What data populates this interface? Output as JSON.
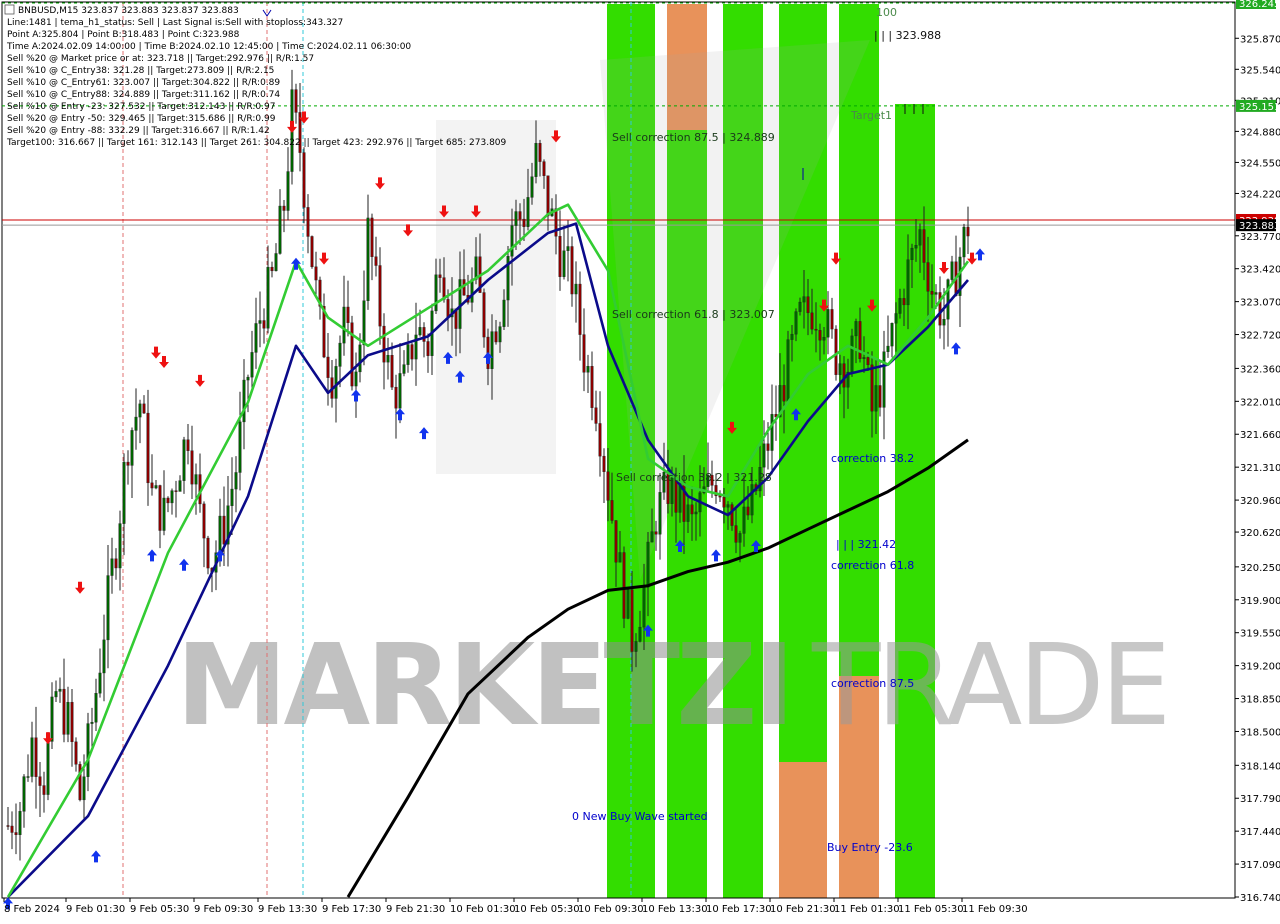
{
  "info": {
    "lines": [
      "BNBUSD,M15  323.837 323.883 323.837 323.883",
      "Line:1481  | tema_h1_status: Sell  | Last Signal is:Sell with stoploss:343.327",
      "Point A:325.804 | Point B:318.483 | Point C:323.988",
      "Time A:2024.02.09 14:00:00 | Time B:2024.02.10 12:45:00 | Time C:2024.02.11 06:30:00",
      "Sell %20 @ Market price or at: 323.718 || Target:292.976 || R/R:1.57",
      "Sell %10 @ C_Entry38: 321.28 || Target:273.809 || R/R:2.15",
      "Sell %10 @ C_Entry61: 323.007 || Target:304.822 || R/R:0.89",
      "Sell %10 @ C_Entry88: 324.889 || Target:311.162 || R/R:0.74",
      "Sell %10 @ Entry -23: 327.532 || Target:312.143 || R/R:0.97",
      "Sell %20 @ Entry -50: 329.465 || Target:315.686 || R/R:0.99",
      "Sell %20 @ Entry -88: 332.29 || Target:316.667 || R/R:1.42",
      "Target100: 316.667 || Target 161: 312.143 || Target 261: 304.822 || Target 423: 292.976 || Target 685: 273.809"
    ]
  },
  "watermark": {
    "part1": "MARKETZI",
    "part2": "TRADE"
  },
  "annotations": {
    "sell_correction_875": "Sell correction 87.5 | 324.889",
    "sell_correction_618": "Sell correction 61.8 | 323.007",
    "sell_correction_382": "Sell correction 38.2 | 321.28",
    "new_buy_wave": "0 New Buy Wave started",
    "correction_382": "correction 38.2",
    "correction_618": "correction 61.8",
    "correction_875": "correction 87.5",
    "buy_entry": "Buy Entry -23.6",
    "target1": "Target1",
    "level_100": "100",
    "level_323988": "| | | 323.988",
    "level_32142": "| | | 321.42"
  },
  "price_tags": {
    "top": "326.245",
    "target_line": "325.151",
    "red_line": "323.938",
    "current": "323.883"
  },
  "colors": {
    "bull_candle": "#006400",
    "bear_candle": "#8b0000",
    "zone_green": "#33dd00",
    "zone_orange": "#e8925a",
    "ma_fast": "#0b0b8a",
    "ma_mid": "#33cc33",
    "ma_slow": "#000000",
    "red_line": "#cc0000",
    "target_line": "#00aa00"
  },
  "chart_data": {
    "type": "candlestick",
    "symbol": "BNBUSD",
    "timeframe": "M15",
    "ylim": [
      316.74,
      326.245
    ],
    "y_ticks": [
      "325.870",
      "325.540",
      "325.210",
      "324.880",
      "324.550",
      "324.220",
      "323.770",
      "323.420",
      "323.070",
      "322.720",
      "322.360",
      "322.010",
      "321.660",
      "321.310",
      "320.960",
      "320.620",
      "320.250",
      "319.900",
      "319.550",
      "319.200",
      "318.850",
      "318.500",
      "318.140",
      "317.790",
      "317.440",
      "317.090",
      "316.740"
    ],
    "x_ticks": [
      "8 Feb 2024",
      "9 Feb 01:30",
      "9 Feb 05:30",
      "9 Feb 09:30",
      "9 Feb 13:30",
      "9 Feb 17:30",
      "9 Feb 21:30",
      "10 Feb 01:30",
      "10 Feb 05:30",
      "10 Feb 09:30",
      "10 Feb 13:30",
      "10 Feb 17:30",
      "10 Feb 21:30",
      "11 Feb 01:30",
      "11 Feb 05:30",
      "11 Feb 09:30"
    ],
    "close_path": [
      [
        0,
        317.5
      ],
      [
        3,
        317.7
      ],
      [
        6,
        318.4
      ],
      [
        9,
        318.0
      ],
      [
        12,
        318.9
      ],
      [
        15,
        318.6
      ],
      [
        18,
        317.8
      ],
      [
        21,
        318.6
      ],
      [
        24,
        319.6
      ],
      [
        27,
        320.5
      ],
      [
        30,
        321.6
      ],
      [
        33,
        322.0
      ],
      [
        36,
        321.0
      ],
      [
        39,
        320.8
      ],
      [
        42,
        321.2
      ],
      [
        45,
        321.7
      ],
      [
        48,
        320.8
      ],
      [
        51,
        320.3
      ],
      [
        54,
        320.7
      ],
      [
        57,
        321.3
      ],
      [
        60,
        322.3
      ],
      [
        63,
        322.9
      ],
      [
        66,
        323.3
      ],
      [
        69,
        324.1
      ],
      [
        71,
        325.1
      ],
      [
        73,
        324.7
      ],
      [
        75,
        323.9
      ],
      [
        78,
        322.8
      ],
      [
        81,
        322.3
      ],
      [
        84,
        322.8
      ],
      [
        87,
        322.2
      ],
      [
        90,
        323.8
      ],
      [
        93,
        322.9
      ],
      [
        96,
        322.1
      ],
      [
        99,
        322.2
      ],
      [
        102,
        322.8
      ],
      [
        105,
        322.6
      ],
      [
        108,
        323.6
      ],
      [
        111,
        322.9
      ],
      [
        114,
        323.1
      ],
      [
        117,
        323.3
      ],
      [
        120,
        322.6
      ],
      [
        123,
        323.0
      ],
      [
        126,
        323.9
      ],
      [
        129,
        324.0
      ],
      [
        132,
        324.6
      ],
      [
        135,
        324.1
      ],
      [
        138,
        323.6
      ],
      [
        141,
        323.3
      ],
      [
        144,
        322.5
      ],
      [
        147,
        322.0
      ],
      [
        150,
        321.1
      ],
      [
        153,
        320.2
      ],
      [
        156,
        319.5
      ],
      [
        159,
        320.0
      ],
      [
        162,
        320.8
      ],
      [
        165,
        321.1
      ],
      [
        168,
        320.9
      ],
      [
        171,
        320.7
      ],
      [
        174,
        321.0
      ],
      [
        177,
        321.2
      ],
      [
        180,
        321.0
      ],
      [
        183,
        320.6
      ],
      [
        186,
        320.9
      ],
      [
        189,
        321.4
      ],
      [
        192,
        321.9
      ],
      [
        195,
        322.4
      ],
      [
        198,
        322.9
      ],
      [
        201,
        323.0
      ],
      [
        204,
        322.9
      ],
      [
        207,
        322.5
      ],
      [
        210,
        322.4
      ],
      [
        213,
        322.7
      ],
      [
        216,
        321.9
      ],
      [
        219,
        322.3
      ],
      [
        222,
        322.9
      ],
      [
        225,
        323.4
      ],
      [
        228,
        323.8
      ],
      [
        231,
        323.2
      ],
      [
        234,
        322.9
      ],
      [
        237,
        323.4
      ],
      [
        240,
        323.883
      ]
    ],
    "series": [
      {
        "values": [
          [
            0,
            316.74
          ],
          [
            20,
            317.6
          ],
          [
            40,
            319.2
          ],
          [
            60,
            321.0
          ],
          [
            72,
            322.6
          ],
          [
            80,
            322.1
          ],
          [
            90,
            322.5
          ],
          [
            105,
            322.7
          ],
          [
            120,
            323.3
          ],
          [
            135,
            323.8
          ],
          [
            142,
            323.9
          ],
          [
            150,
            322.6
          ],
          [
            160,
            321.6
          ],
          [
            170,
            321.0
          ],
          [
            180,
            320.8
          ],
          [
            190,
            321.2
          ],
          [
            200,
            321.8
          ],
          [
            210,
            322.3
          ],
          [
            220,
            322.4
          ],
          [
            230,
            322.8
          ],
          [
            240,
            323.3
          ]
        ]
      },
      {
        "values": [
          [
            0,
            316.74
          ],
          [
            20,
            318.2
          ],
          [
            40,
            320.4
          ],
          [
            60,
            322.0
          ],
          [
            72,
            323.5
          ],
          [
            80,
            322.9
          ],
          [
            90,
            322.6
          ],
          [
            105,
            323.0
          ],
          [
            120,
            323.4
          ],
          [
            135,
            324.0
          ],
          [
            140,
            324.1
          ],
          [
            150,
            323.4
          ],
          [
            160,
            321.4
          ],
          [
            170,
            321.1
          ],
          [
            180,
            321.0
          ],
          [
            190,
            321.7
          ],
          [
            200,
            322.3
          ],
          [
            210,
            322.6
          ],
          [
            220,
            322.4
          ],
          [
            230,
            322.9
          ],
          [
            240,
            323.5
          ]
        ]
      },
      {
        "values": [
          [
            85,
            316.74
          ],
          [
            100,
            317.8
          ],
          [
            115,
            318.9
          ],
          [
            130,
            319.5
          ],
          [
            140,
            319.8
          ],
          [
            150,
            320.0
          ],
          [
            160,
            320.05
          ],
          [
            170,
            320.2
          ],
          [
            180,
            320.3
          ],
          [
            190,
            320.45
          ],
          [
            200,
            320.65
          ],
          [
            210,
            320.85
          ],
          [
            220,
            321.05
          ],
          [
            230,
            321.3
          ],
          [
            240,
            321.6
          ]
        ]
      }
    ],
    "levels": [
      {
        "label": "326.245",
        "value": 326.245
      },
      {
        "label": "325.151",
        "value": 325.151
      },
      {
        "label": "323.938",
        "value": 323.938
      },
      {
        "label": "323.883",
        "value": 323.883
      }
    ],
    "arrows_buy": [
      [
        0,
        316.8
      ],
      [
        22,
        317.3
      ],
      [
        36,
        320.5
      ],
      [
        44,
        320.4
      ],
      [
        53,
        320.5
      ],
      [
        72,
        323.6
      ],
      [
        87,
        322.2
      ],
      [
        98,
        322.0
      ],
      [
        104,
        321.8
      ],
      [
        110,
        322.6
      ],
      [
        113,
        322.4
      ],
      [
        120,
        322.6
      ],
      [
        168,
        320.6
      ],
      [
        177,
        320.5
      ],
      [
        187,
        320.6
      ],
      [
        197,
        322.0
      ],
      [
        237,
        322.7
      ],
      [
        243,
        323.7
      ],
      [
        160,
        319.7
      ]
    ],
    "arrows_sell": [
      [
        10,
        318.3
      ],
      [
        18,
        319.9
      ],
      [
        37,
        322.4
      ],
      [
        39,
        322.3
      ],
      [
        48,
        322.1
      ],
      [
        71,
        324.8
      ],
      [
        74,
        324.9
      ],
      [
        79,
        323.4
      ],
      [
        93,
        324.2
      ],
      [
        100,
        323.7
      ],
      [
        109,
        323.9
      ],
      [
        117,
        323.9
      ],
      [
        137,
        324.7
      ],
      [
        181,
        321.6
      ],
      [
        207,
        323.4
      ],
      [
        204,
        322.9
      ],
      [
        216,
        322.9
      ],
      [
        234,
        323.3
      ],
      [
        241,
        323.4
      ]
    ]
  }
}
